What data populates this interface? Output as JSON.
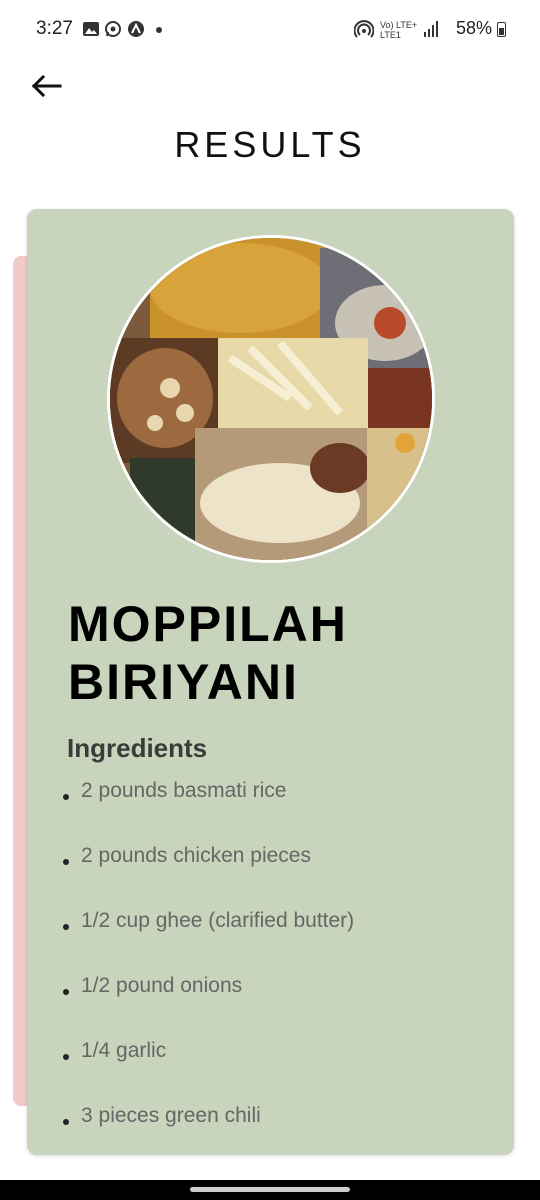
{
  "status_bar": {
    "time": "3:27",
    "network": "Vo) LTE+ LTE1",
    "battery": "58%"
  },
  "header": {
    "title": "RESULTS"
  },
  "recipe": {
    "name": "MOPPILAH BIRIYANI",
    "ingredients_heading": "Ingredients",
    "ingredients": [
      "2 pounds basmati rice",
      "2 pounds chicken pieces",
      "1/2 cup ghee (clarified butter)",
      "1/2 pound onions",
      "1/4 garlic",
      "3 pieces green chili"
    ]
  },
  "icons": {
    "back": "arrow-left-icon",
    "gallery": "image-icon",
    "whatsapp": "whatsapp-icon",
    "app": "app-icon",
    "hotspot": "hotspot-icon",
    "signal": "signal-icon",
    "battery": "battery-icon"
  },
  "colors": {
    "card_background": "#c8d4bc",
    "card_behind": "#f1cbcc",
    "title_text": "#111111",
    "ingredient_text": "#666666"
  }
}
